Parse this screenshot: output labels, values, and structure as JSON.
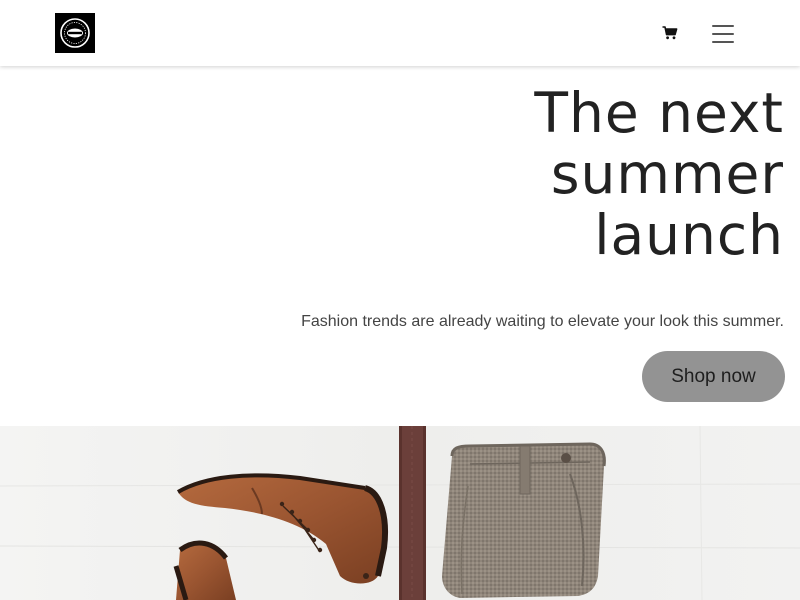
{
  "header": {
    "logo_icon": "brand-badge-logo",
    "cart_icon": "shopping-cart-icon",
    "menu_icon": "hamburger-menu-icon"
  },
  "hero": {
    "title_line_1": "The next",
    "title_line_2": "summer",
    "title_line_3": "launch",
    "subtitle": "Fashion trends are already waiting to elevate your look this summer.",
    "cta_label": "Shop now"
  },
  "colors": {
    "header_bg": "#ffffff",
    "cta_bg": "#939393",
    "title_text": "#222222",
    "boot_leather": "#9a5531",
    "belt": "#6b3f3a",
    "trousers": "#8e8377"
  }
}
